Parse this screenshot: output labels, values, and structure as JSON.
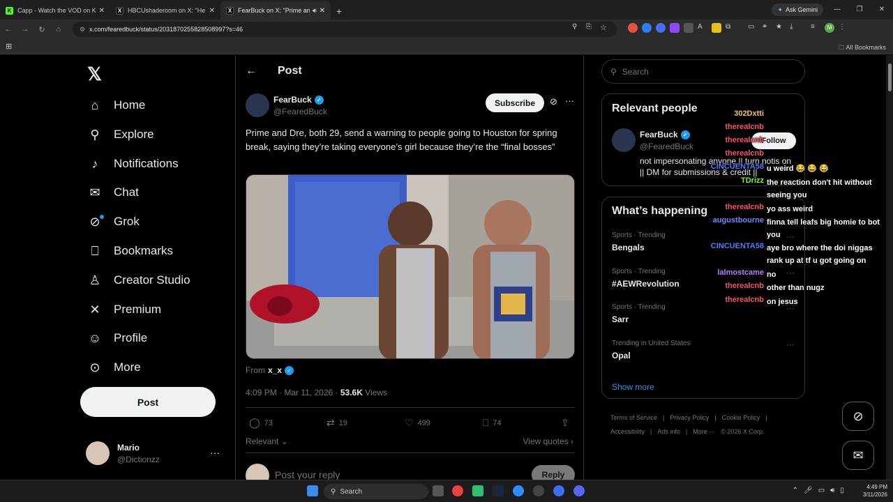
{
  "browser": {
    "tabs": [
      {
        "title": "Capp - Watch the VOD on Kick",
        "color": "#53fc18",
        "glyph": "K"
      },
      {
        "title": "HBCUshaderoom on X: \"He wa",
        "color": "#000000",
        "glyph": "𝕏"
      },
      {
        "title": "FearBuck on X: \"Prime and",
        "color": "#000000",
        "glyph": "𝕏"
      }
    ],
    "ask_gemini": "Ask Gemini",
    "url": "x.com/fearedbuck/status/2031870255828508997?s=46",
    "all_bookmarks": "All Bookmarks"
  },
  "nav": {
    "items": [
      {
        "label": "Home",
        "icon": "home-icon",
        "glyph": "⌂"
      },
      {
        "label": "Explore",
        "icon": "search-icon",
        "glyph": "⚲"
      },
      {
        "label": "Notifications",
        "icon": "bell-icon",
        "glyph": "🔔︎"
      },
      {
        "label": "Chat",
        "icon": "mail-icon",
        "glyph": "✉"
      },
      {
        "label": "Grok",
        "icon": "grok-icon",
        "glyph": "⊘"
      },
      {
        "label": "Bookmarks",
        "icon": "bookmark-icon",
        "glyph": "⎕"
      },
      {
        "label": "Creator Studio",
        "icon": "creator-studio-icon",
        "glyph": "♙"
      },
      {
        "label": "Premium",
        "icon": "x-premium-icon",
        "glyph": "✕"
      },
      {
        "label": "Profile",
        "icon": "person-icon",
        "glyph": "☺"
      },
      {
        "label": "More",
        "icon": "more-circle-icon",
        "glyph": "⋯"
      }
    ],
    "post_label": "Post",
    "user": {
      "name": "Mario",
      "handle": "@Dictionzz"
    }
  },
  "post": {
    "header_title": "Post",
    "author_name": "FearBuck",
    "author_handle": "@FearedBuck",
    "subscribe_label": "Subscribe",
    "text": "Prime and Dre, both 29, send a warning to people going to Houston for spring break, saying they’re taking everyone’s girl because they’re the “final bosses”",
    "from_label": "From",
    "from_user": "x_x",
    "time": "4:09 PM · Mar 11, 2026 · ",
    "views_count": "53.6K",
    "views_label": " Views",
    "replies": "73",
    "reposts": "19",
    "likes": "499",
    "bookmarks": "74",
    "relevant_label": "Relevant",
    "view_quotes_label": "View quotes",
    "reply_placeholder": "Post your reply",
    "reply_button": "Reply"
  },
  "sidebar": {
    "search_placeholder": "Search",
    "relevant_title": "Relevant people",
    "person": {
      "name": "FearBuck",
      "handle": "@FearedBuck",
      "follow_label": "Follow",
      "bio": "not impersonating anyone || turn notis on || DM for submissions & credit ||"
    },
    "happening_title": "What’s happening",
    "trends": [
      {
        "category": "Sports · Trending",
        "name": "Bengals"
      },
      {
        "category": "Sports · Trending",
        "name": "#AEWRevolution"
      },
      {
        "category": "Sports · Trending",
        "name": "Sarr"
      },
      {
        "category": "Trending in United States",
        "name": "Opal"
      }
    ],
    "show_more": "Show more",
    "footer": [
      "Terms of Service",
      "|",
      "Privacy Policy",
      "|",
      "Cookie Policy",
      "|",
      "Accessibility",
      "|",
      "Ads info",
      "|",
      "More ···",
      "© 2026 X Corp."
    ]
  },
  "chat_overlay": [
    {
      "user": "302Dxtti",
      "color": "#f2c94c",
      "msg": ""
    },
    {
      "user": "therealcnb",
      "color": "#ff4d6d",
      "msg": ""
    },
    {
      "user": "therealcnb",
      "color": "#ff4d6d",
      "msg": ""
    },
    {
      "user": "therealcnb",
      "color": "#ff4d6d",
      "msg": ""
    },
    {
      "user": "CINCUENTA58",
      "color": "#4f7dff",
      "msg": "u weird 😂 😂 😂"
    },
    {
      "user": "TDrizz",
      "color": "#7cfc00",
      "msg": "the reaction don't hit without seeing you"
    },
    {
      "user": "therealcnb",
      "color": "#ff4d6d",
      "msg": "yo ass weird"
    },
    {
      "user": "augustbourne",
      "color": "#6a8cff",
      "msg": "finna tell leafs big homie to bot you"
    },
    {
      "user": "CINCUENTA58",
      "color": "#4f7dff",
      "msg": "aye bro where the doi niggas rank up at tf u got going on"
    },
    {
      "user": "lalmostcame",
      "color": "#b57bff",
      "msg": "no"
    },
    {
      "user": "therealcnb",
      "color": "#ff4d6d",
      "msg": "other than nugz"
    },
    {
      "user": "therealcnb",
      "color": "#ff4d6d",
      "msg": "on jesus"
    }
  ],
  "taskbar": {
    "search_label": "Search",
    "time": "4:49 PM",
    "date": "3/11/2026"
  }
}
